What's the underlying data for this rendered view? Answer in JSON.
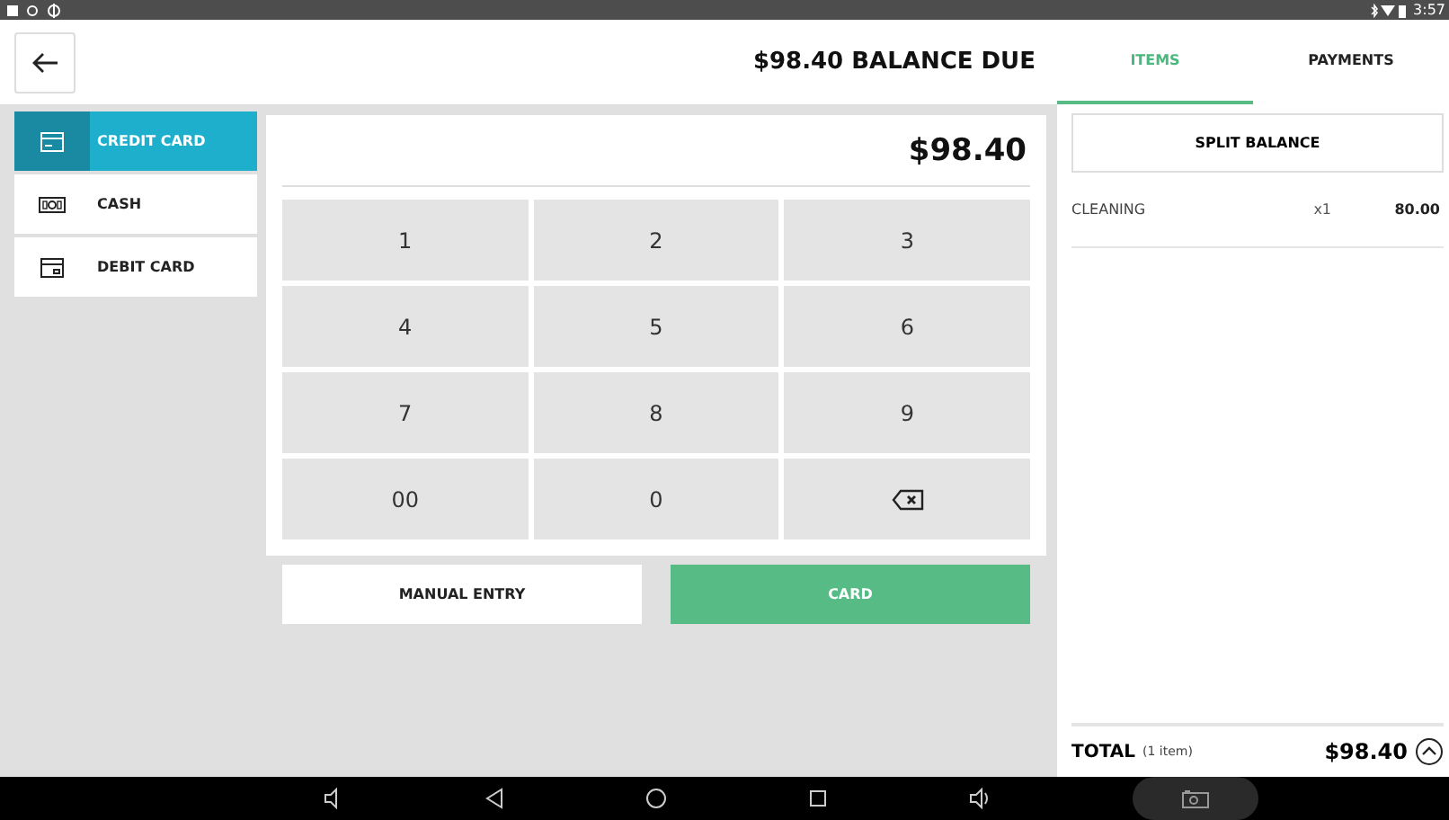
{
  "status_bar": {
    "time": "3:57"
  },
  "header": {
    "title": "$98.40 BALANCE DUE"
  },
  "tabs": [
    {
      "label": "ITEMS",
      "selected": true
    },
    {
      "label": "PAYMENTS",
      "selected": false
    }
  ],
  "payment_methods": [
    {
      "label": "CREDIT CARD",
      "kind": "credit",
      "selected": true
    },
    {
      "label": "CASH",
      "kind": "cash",
      "selected": false
    },
    {
      "label": "DEBIT CARD",
      "kind": "debit",
      "selected": false
    }
  ],
  "amount": "$98.40",
  "keypad": [
    {
      "kind": "digit",
      "label": "1"
    },
    {
      "kind": "digit",
      "label": "2"
    },
    {
      "kind": "digit",
      "label": "3"
    },
    {
      "kind": "digit",
      "label": "4"
    },
    {
      "kind": "digit",
      "label": "5"
    },
    {
      "kind": "digit",
      "label": "6"
    },
    {
      "kind": "digit",
      "label": "7"
    },
    {
      "kind": "digit",
      "label": "8"
    },
    {
      "kind": "digit",
      "label": "9"
    },
    {
      "kind": "digit",
      "label": "00"
    },
    {
      "kind": "digit",
      "label": "0"
    },
    {
      "kind": "backspace"
    }
  ],
  "actions": [
    {
      "label": "MANUAL ENTRY",
      "kind": "secondary"
    },
    {
      "label": "CARD",
      "kind": "primary"
    }
  ],
  "split_button": "SPLIT BALANCE",
  "items": [
    {
      "name": "CLEANING",
      "quantity": "x1",
      "price": "80.00"
    }
  ],
  "total": {
    "label": "TOTAL",
    "count": "(1 item)",
    "amount": "$98.40"
  }
}
